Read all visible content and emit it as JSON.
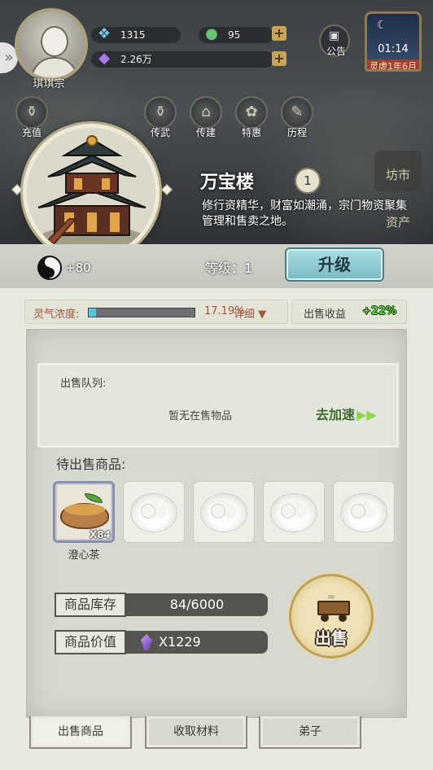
{
  "header": {
    "sect_name": "琪琪宗",
    "resources": [
      {
        "icon": "spirit-stone-icon",
        "value": "1315"
      },
      {
        "icon": "jade-coin-icon",
        "value": "95"
      },
      {
        "icon": "purple-gem-icon",
        "value": "2.26万"
      }
    ],
    "notice_label": "公告",
    "clock": {
      "time": "01:14",
      "date": "灵虚1年6月"
    }
  },
  "shortcuts": [
    {
      "label": "充值",
      "icon": "gourd-icon"
    },
    {
      "label": "传武",
      "icon": "gourd-icon"
    },
    {
      "label": "传建",
      "icon": "pavilion-icon"
    },
    {
      "label": "特惠",
      "icon": "gift-icon"
    },
    {
      "label": "历程",
      "icon": "scroll-icon"
    }
  ],
  "side_icons": {
    "market": "坊市",
    "assets": "资产"
  },
  "building": {
    "name": "万宝楼",
    "level_badge": "1",
    "description": "修行资精华，财富如潮涌，宗门物资聚集管理和售卖之地。",
    "qi_bonus": "+80",
    "level_text": "等级：1",
    "upgrade_label": "升级"
  },
  "stats": {
    "aura_label": "灵气浓度:",
    "aura_percent": "17.19%",
    "aura_fraction": 0.0719,
    "detail_label": "详细 ▼",
    "sell_label": "出售收益",
    "sell_bonus": "+22%"
  },
  "queue": {
    "title": "出售队列:",
    "empty_text": "暂无在售物品",
    "speedup_label": "去加速"
  },
  "pending": {
    "title": "待出售商品:",
    "items": [
      {
        "name": "澄心茶",
        "count": "X84",
        "icon": "tea-bowl-icon"
      }
    ]
  },
  "inventory": {
    "stock_label": "商品库存",
    "stock_value": "84/6000",
    "value_label": "商品价值",
    "value_amount": "X1229"
  },
  "sell_button_label": "出售",
  "tabs": [
    "出售商品",
    "收取材料",
    "弟子"
  ],
  "colors": {
    "accent_green": "#5bd23c",
    "aura_bar": "#52c7de",
    "upgrade_button": "#a9dde4"
  }
}
